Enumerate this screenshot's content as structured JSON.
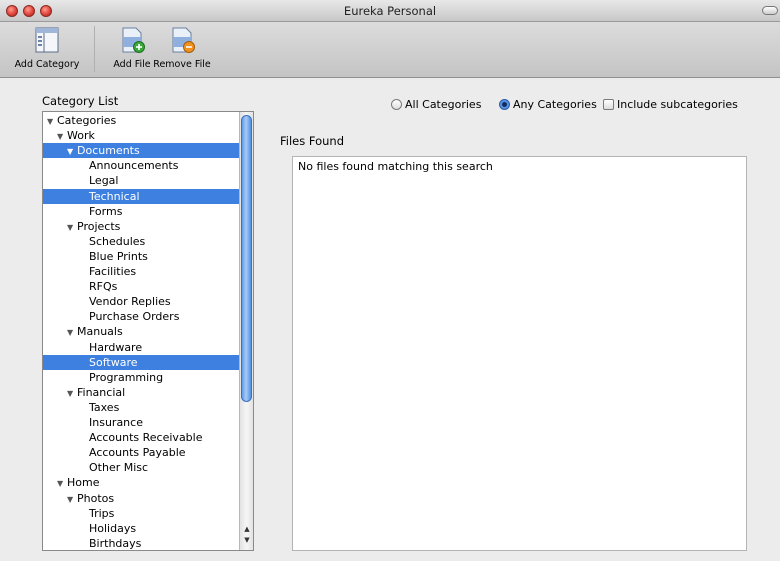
{
  "window": {
    "title": "Eureka Personal"
  },
  "toolbar": {
    "add_category": "Add Category",
    "add_file": "Add File",
    "remove_file": "Remove File"
  },
  "category_list": {
    "label": "Category List",
    "items": [
      {
        "label": "Categories",
        "level": 0,
        "expanded": true,
        "selected": false
      },
      {
        "label": "Work",
        "level": 1,
        "expanded": true,
        "selected": false
      },
      {
        "label": "Documents",
        "level": 2,
        "expanded": true,
        "selected": true
      },
      {
        "label": "Announcements",
        "level": 3,
        "selected": false
      },
      {
        "label": "Legal",
        "level": 3,
        "selected": false
      },
      {
        "label": "Technical",
        "level": 3,
        "selected": true
      },
      {
        "label": "Forms",
        "level": 3,
        "selected": false
      },
      {
        "label": "Projects",
        "level": 2,
        "expanded": true,
        "selected": false
      },
      {
        "label": "Schedules",
        "level": 3,
        "selected": false
      },
      {
        "label": "Blue Prints",
        "level": 3,
        "selected": false
      },
      {
        "label": "Facilities",
        "level": 3,
        "selected": false
      },
      {
        "label": "RFQs",
        "level": 3,
        "selected": false
      },
      {
        "label": "Vendor Replies",
        "level": 3,
        "selected": false
      },
      {
        "label": "Purchase Orders",
        "level": 3,
        "selected": false
      },
      {
        "label": "Manuals",
        "level": 2,
        "expanded": true,
        "selected": false
      },
      {
        "label": "Hardware",
        "level": 3,
        "selected": false
      },
      {
        "label": "Software",
        "level": 3,
        "selected": true
      },
      {
        "label": "Programming",
        "level": 3,
        "selected": false
      },
      {
        "label": "Financial",
        "level": 2,
        "expanded": true,
        "selected": false
      },
      {
        "label": "Taxes",
        "level": 3,
        "selected": false
      },
      {
        "label": "Insurance",
        "level": 3,
        "selected": false
      },
      {
        "label": "Accounts Receivable",
        "level": 3,
        "selected": false
      },
      {
        "label": "Accounts Payable",
        "level": 3,
        "selected": false
      },
      {
        "label": "Other Misc",
        "level": 3,
        "selected": false
      },
      {
        "label": "Home",
        "level": 1,
        "expanded": true,
        "selected": false
      },
      {
        "label": "Photos",
        "level": 2,
        "expanded": true,
        "selected": false
      },
      {
        "label": "Trips",
        "level": 3,
        "selected": false
      },
      {
        "label": "Holidays",
        "level": 3,
        "selected": false
      },
      {
        "label": "Birthdays",
        "level": 3,
        "selected": false
      }
    ]
  },
  "search_options": {
    "all_categories": "All Categories",
    "any_categories": "Any Categories",
    "include_subcategories": "Include subcategories",
    "selected": "any_categories",
    "include_subcategories_checked": false
  },
  "files": {
    "label": "Files Found",
    "empty_message": "No files found matching this search"
  }
}
